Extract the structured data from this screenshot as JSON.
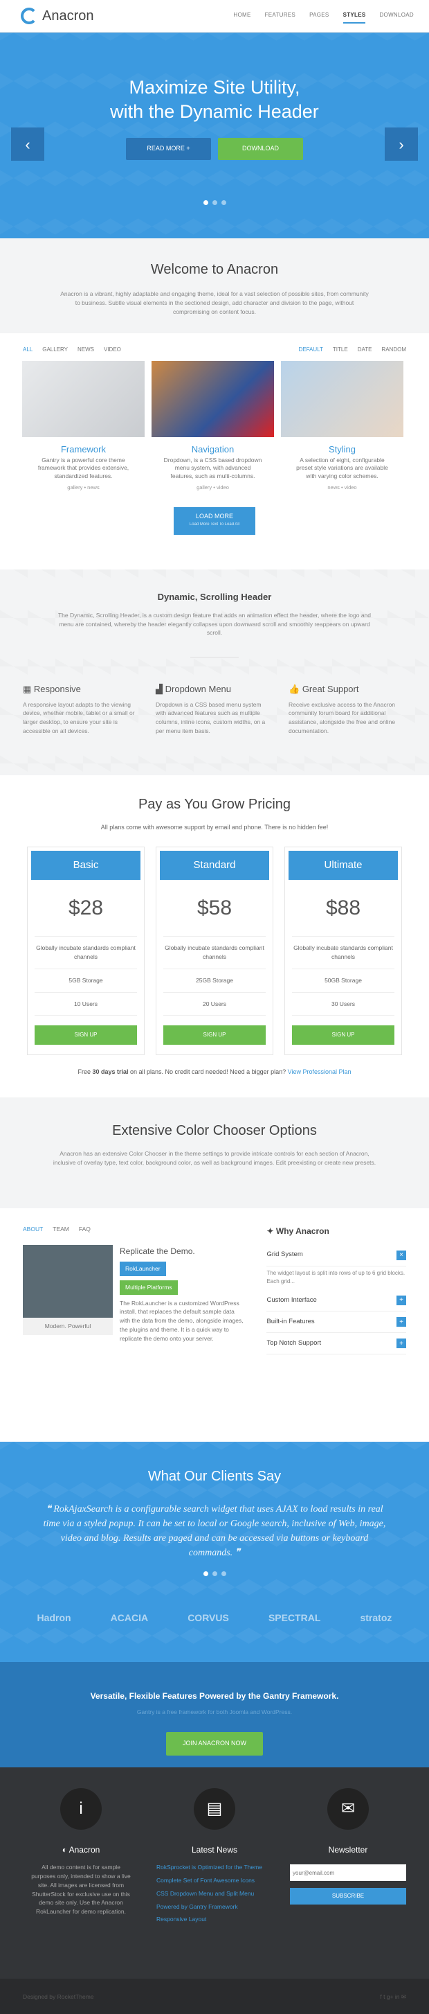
{
  "header": {
    "brand": "Anacron",
    "nav": [
      "HOME",
      "FEATURES",
      "PAGES",
      "STYLES",
      "DOWNLOAD"
    ]
  },
  "hero": {
    "line1": "Maximize Site Utility,",
    "line2": "with the Dynamic Header",
    "btn_more": "READ MORE +",
    "btn_download": "DOWNLOAD"
  },
  "welcome": {
    "title": "Welcome to Anacron",
    "text": "Anacron is a vibrant, highly adaptable and engaging theme, ideal for a vast selection of possible sites, from community to business. Subtle visual elements in the sectioned design, add character and division to the page, without compromising on content focus."
  },
  "filters": {
    "left": [
      "ALL",
      "GALLERY",
      "NEWS",
      "VIDEO"
    ],
    "right": [
      "DEFAULT",
      "TITLE",
      "DATE",
      "RANDOM"
    ]
  },
  "cards": [
    {
      "title": "Framework",
      "text": "Gantry is a powerful core theme framework that provides extensive, standardized features.",
      "tags": "gallery • news"
    },
    {
      "title": "Navigation",
      "text": "Dropdown, is a CSS based dropdown menu system, with advanced features, such as multi-columns.",
      "tags": "gallery • video"
    },
    {
      "title": "Styling",
      "text": "A selection of eight, configurable preset style variations are available with varying color schemes.",
      "tags": "news • video"
    }
  ],
  "loadmore": {
    "label": "LOAD MORE",
    "sub": "Load More Text To Load All"
  },
  "scroll": {
    "title": "Dynamic, Scrolling Header",
    "text": "The Dynamic, Scrolling Header, is a custom design feature that adds an animation effect the header, where the logo and menu are contained, whereby the header elegantly collapses upon downward scroll and smoothly reappears on upward scroll."
  },
  "features": [
    {
      "title": "Responsive",
      "text": "A responsive layout adapts to the viewing device, whether mobile, tablet or a small or larger desktop, to ensure your site is accessible on all devices."
    },
    {
      "title": "Dropdown Menu",
      "text": "Dropdown is a CSS based menu system with advanced features such as multiple columns, inline icons, custom widths, on a per menu item basis."
    },
    {
      "title": "Great Support",
      "text": "Receive exclusive access to the Anacron community forum board for additional assistance, alongside the free and online documentation."
    }
  ],
  "pricing": {
    "title": "Pay as You Grow Pricing",
    "sub": "All plans come with awesome support by email and phone. There is no hidden fee!",
    "plans": [
      {
        "name": "Basic",
        "price": "$28",
        "desc": "Globally incubate standards compliant channels",
        "storage": "5GB Storage",
        "users": "10 Users",
        "cta": "SIGN UP"
      },
      {
        "name": "Standard",
        "price": "$58",
        "desc": "Globally incubate standards compliant channels",
        "storage": "25GB Storage",
        "users": "20 Users",
        "cta": "SIGN UP"
      },
      {
        "name": "Ultimate",
        "price": "$88",
        "desc": "Globally incubate standards compliant channels",
        "storage": "50GB Storage",
        "users": "30 Users",
        "cta": "SIGN UP"
      }
    ],
    "trial_a": "Free ",
    "trial_b": "30 days trial",
    "trial_c": " on all plans. No credit card needed! Need a bigger plan? ",
    "trial_link": "View Professional Plan"
  },
  "color": {
    "title": "Extensive Color Chooser Options",
    "text": "Anacron has an extensive Color Chooser in the theme settings to provide intricate controls for each section of Anacron, inclusive of overlay type, text color, background color, as well as background images. Edit preexisting or create new presets."
  },
  "about": {
    "tabs": [
      "ABOUT",
      "TEAM",
      "FAQ"
    ],
    "caption": "Modern. Powerful",
    "title": "Replicate the Demo.",
    "chip1": "RokLauncher",
    "chip2": "Multiple Platforms",
    "text": "The RokLauncher is a customized WordPress install, that replaces the default sample data with the data from the demo, alongside images, the plugins and theme. It is a quick way to replicate the demo onto your server."
  },
  "why": {
    "title": "Why Anacron",
    "items": [
      {
        "label": "Grid System",
        "text": "The widget layout is split into rows of up to 6 grid blocks. Each grid..."
      },
      {
        "label": "Custom Interface"
      },
      {
        "label": "Built-in Features"
      },
      {
        "label": "Top Notch Support"
      }
    ]
  },
  "clients": {
    "title": "What Our Clients Say",
    "quote": "RokAjaxSearch is a configurable search widget that uses AJAX to load results in real time via a styled popup. It can be set to local or Google search, inclusive of Web, image, video and blog. Results are paged and can be accessed via buttons or keyboard commands.",
    "logos": [
      "Hadron",
      "ACACIA",
      "CORVUS",
      "SPECTRAL",
      "stratoz"
    ]
  },
  "gantry": {
    "title": "Versatile, Flexible Features Powered by the Gantry Framework.",
    "sub": "Gantry is a free framework for both Joomla and WordPress.",
    "cta": "JOIN ANACRON NOW"
  },
  "footer": {
    "brand": "Anacron",
    "about": "All demo content is for sample purposes only, intended to show a live site. All images are licensed from ShutterStock for exclusive use on this demo site only. Use the Anacron RokLauncher for demo replication.",
    "news_title": "Latest News",
    "news": [
      "RokSprocket is Optimized for the Theme",
      "Complete Set of Font Awesome Icons",
      "CSS Dropdown Menu and Split Menu",
      "Powered by Gantry Framework",
      "Responsive Layout"
    ],
    "newsletter_title": "Newsletter",
    "email_ph": "your@email.com",
    "subscribe": "SUBSCRIBE",
    "credit": "Designed by RocketTheme"
  }
}
